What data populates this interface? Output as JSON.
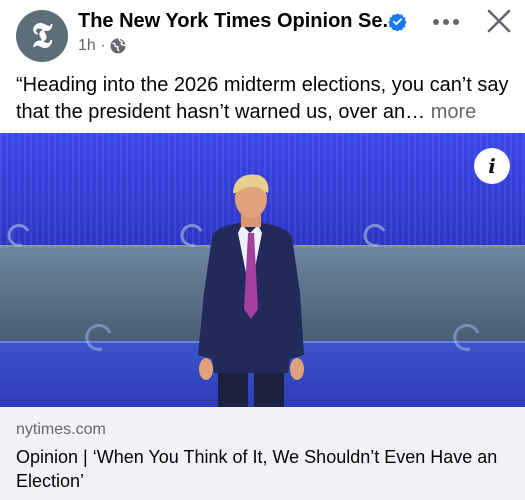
{
  "header": {
    "avatar_icon": "nyt-t-logo-icon",
    "avatar_glyph": "𝕿",
    "page_name": "The New York Times Opinion Se...",
    "verified_icon": "verified-badge-icon",
    "time": "1h ·",
    "audience_icon": "globe-icon",
    "more_icon": "more-dots-icon",
    "close_icon": "close-icon"
  },
  "post": {
    "caption": "“Heading into the 2026 midterm elections, you can’t say that the president hasn’t warned us, over an…",
    "more_label": "more"
  },
  "image": {
    "info_icon": "info-icon",
    "info_glyph": "i"
  },
  "link": {
    "domain": "nytimes.com",
    "title": "Opinion | ‘When You Think of It, We Shouldn’t Even Have an Election’"
  },
  "colors": {
    "verified": "#1877f2",
    "muted": "#65676b",
    "link_bg": "#f0f2f5"
  }
}
